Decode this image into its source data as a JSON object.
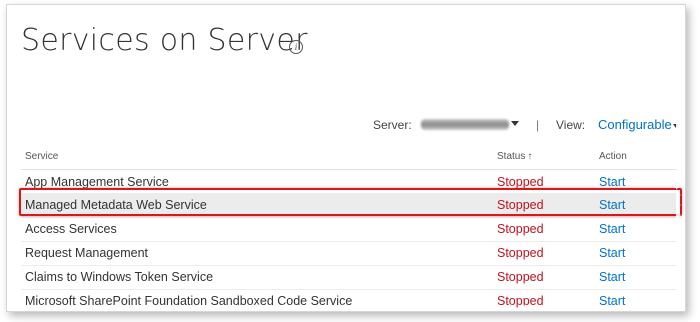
{
  "page": {
    "title": "Services on Server",
    "info_icon": "info-circle-icon"
  },
  "toolbar": {
    "server_label": "Server:",
    "server_value": "",
    "separator": "|",
    "view_label": "View:",
    "view_value": "Configurable"
  },
  "table": {
    "headers": {
      "service": "Service",
      "status": "Status",
      "status_sort_indicator": "↑",
      "action": "Action"
    },
    "rows": [
      {
        "service": "App Management Service",
        "status": "Stopped",
        "action": "Start"
      },
      {
        "service": "Managed Metadata Web Service",
        "status": "Stopped",
        "action": "Start"
      },
      {
        "service": "Access Services",
        "status": "Stopped",
        "action": "Start"
      },
      {
        "service": "Request Management",
        "status": "Stopped",
        "action": "Start"
      },
      {
        "service": "Claims to Windows Token Service",
        "status": "Stopped",
        "action": "Start"
      },
      {
        "service": "Microsoft SharePoint Foundation Sandboxed Code Service",
        "status": "Stopped",
        "action": "Start"
      }
    ]
  },
  "colors": {
    "status_stopped": "#c1121f",
    "link": "#0072c6",
    "highlight_border": "#d41a1a"
  }
}
